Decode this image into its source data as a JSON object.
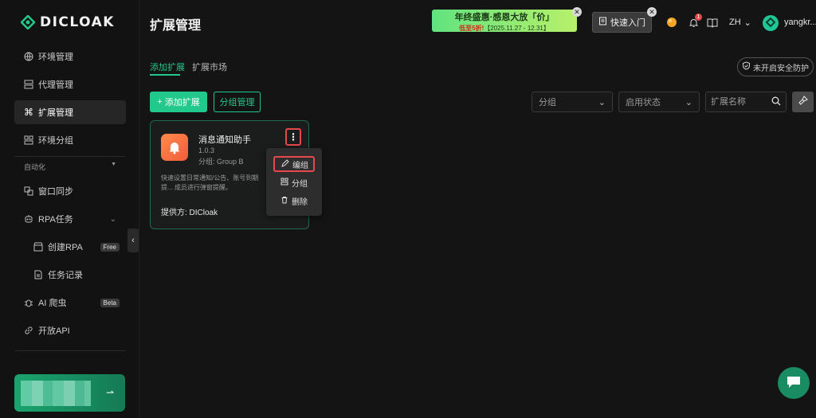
{
  "app": {
    "logo_text": "DICLOAK",
    "brand_color": "#22c98c"
  },
  "sidebar": {
    "items": [
      {
        "label": "环境管理",
        "icon": "globe-icon"
      },
      {
        "label": "代理管理",
        "icon": "proxy-icon"
      },
      {
        "label": "扩展管理",
        "icon": "command-icon",
        "active": true
      },
      {
        "label": "环境分组",
        "icon": "group-icon"
      }
    ],
    "section_label": "自动化",
    "automation_items": [
      {
        "label": "窗口同步",
        "icon": "sync-window-icon"
      },
      {
        "label": "RPA任务",
        "icon": "robot-icon"
      }
    ],
    "rpa_sub": [
      {
        "label": "创建RPA",
        "icon": "store-icon",
        "tag": "Free"
      },
      {
        "label": "任务记录",
        "icon": "document-icon"
      }
    ],
    "extra_items": [
      {
        "label": "AI 爬虫",
        "icon": "bug-icon",
        "tag": "Beta"
      },
      {
        "label": "开放API",
        "icon": "link-icon"
      }
    ]
  },
  "header": {
    "title": "扩展管理",
    "promo": {
      "line1": "年终盛惠·感恩大放「价」",
      "line2_red": "低至5折!",
      "line2": "【2025.11.27 - 12.31】"
    },
    "quick_start": "快速入门",
    "notification_count": "1",
    "language": "ZH",
    "user_name": "yangkr..."
  },
  "tabs": [
    {
      "label": "添加扩展",
      "active": true
    },
    {
      "label": "扩展市场",
      "active": false
    }
  ],
  "security_label": "未开启安全防护",
  "toolbar": {
    "add_label": "添加扩展",
    "group_manage_label": "分组管理",
    "group_select": "分组",
    "status_select": "启用状态",
    "search_placeholder": "扩展名称"
  },
  "extension_card": {
    "name": "消息通知助手",
    "version": "1.0.3",
    "group": "分组: Group B",
    "description": "快速设置日常通知/公告、账号到期提... 成员进行弹窗提醒。",
    "provider": "提供方: DICloak"
  },
  "context_menu": {
    "items": [
      {
        "label": "编组",
        "icon": "pencil-icon"
      },
      {
        "label": "分组",
        "icon": "group-icon"
      },
      {
        "label": "删除",
        "icon": "trash-icon"
      }
    ]
  }
}
